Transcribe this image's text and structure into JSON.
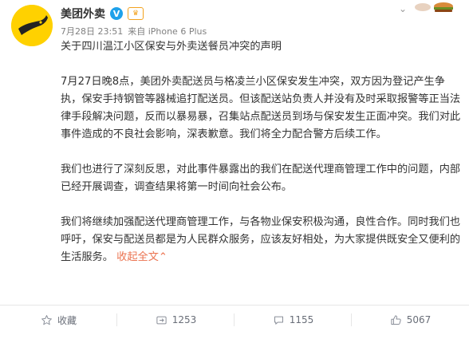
{
  "post": {
    "author": "美团外卖",
    "date": "7月28日 23:51",
    "via": "来自 iPhone 6 Plus",
    "title": "关于四川温江小区保安与外卖送餐员冲突的声明",
    "paragraphs": [
      "7月27日晚8点，美团外卖配送员与格凌兰小区保安发生冲突，双方因为登记产生争执，保安手持钢管等器械追打配送员。但该配送站负责人并没有及时采取报警等正当法律手段解决问题，反而以暴易暴，召集站点配送员到场与保安发生正面冲突。我们对此事件造成的不良社会影响，深表歉意。我们将全力配合警方后续工作。",
      "我们也进行了深刻反思，对此事件暴露出的我们在配送代理商管理工作中的问题，内部已经开展调查，调查结果将第一时间向社会公布。",
      "我们将继续加强配送代理商管理工作，与各物业保安积极沟通，良性合作。同时我们也呼吁，保安与配送员都是为人民群众服务，应该友好相处，为大家提供既安全又便利的生活服务。"
    ],
    "collapse_label": "收起全文",
    "collapse_suffix": "⌃"
  },
  "actions": {
    "favorite": "收藏",
    "repost": "1253",
    "comment": "1155",
    "like": "5067"
  },
  "colors": {
    "accent": "#eb7350",
    "avatar_bg": "#ffd100",
    "vip_blue": "#1fa1ea"
  }
}
